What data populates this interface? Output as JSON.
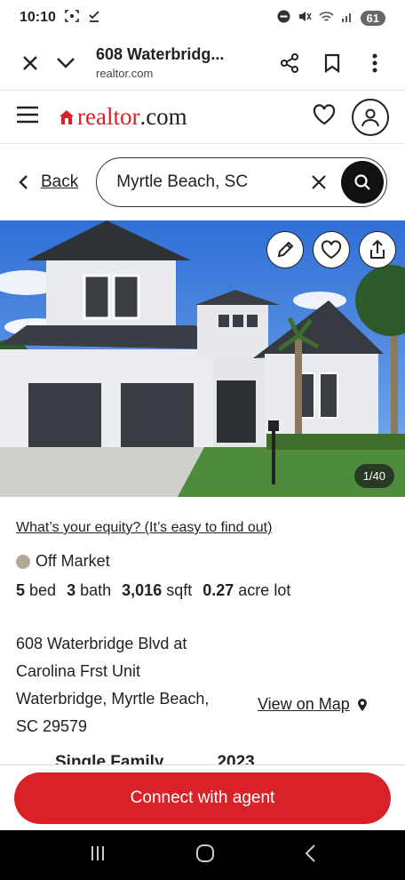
{
  "status_bar": {
    "time": "10:10",
    "battery": "61"
  },
  "browser_tab": {
    "title": "608 Waterbridg...",
    "url": "realtor.com"
  },
  "site": {
    "logo_main": "realtor",
    "logo_suffix": ".com",
    "brand_color": "#d92228"
  },
  "search": {
    "back_label": "Back",
    "query": "Myrtle Beach, SC"
  },
  "photo": {
    "counter": "1/40"
  },
  "listing": {
    "equity_link": "What’s your equity? (It’s easy to find out)",
    "status": "Off Market",
    "beds": "5",
    "beds_label": "bed",
    "baths": "3",
    "baths_label": "bath",
    "sqft": "3,016",
    "sqft_label": "sqft",
    "lot": "0.27",
    "lot_label": "acre lot",
    "address_lines": [
      "608 Waterbridge Blvd at",
      "Carolina Frst Unit",
      "Waterbridge, Myrtle Beach,",
      "SC 29579"
    ],
    "map_link": "View on Map",
    "peek_type": "Single Family",
    "peek_year": "2023"
  },
  "cta": {
    "label": "Connect with agent"
  },
  "icons": [
    "close-icon",
    "chevron-down-icon",
    "share-icon",
    "bookmark-icon",
    "more-vert-icon",
    "menu-icon",
    "heart-icon",
    "user-icon",
    "chevron-left-icon",
    "close-icon",
    "search-icon",
    "pencil-icon",
    "heart-icon",
    "share-upload-icon",
    "location-pin-icon",
    "nav-recents-icon",
    "nav-home-icon",
    "nav-back-icon"
  ]
}
